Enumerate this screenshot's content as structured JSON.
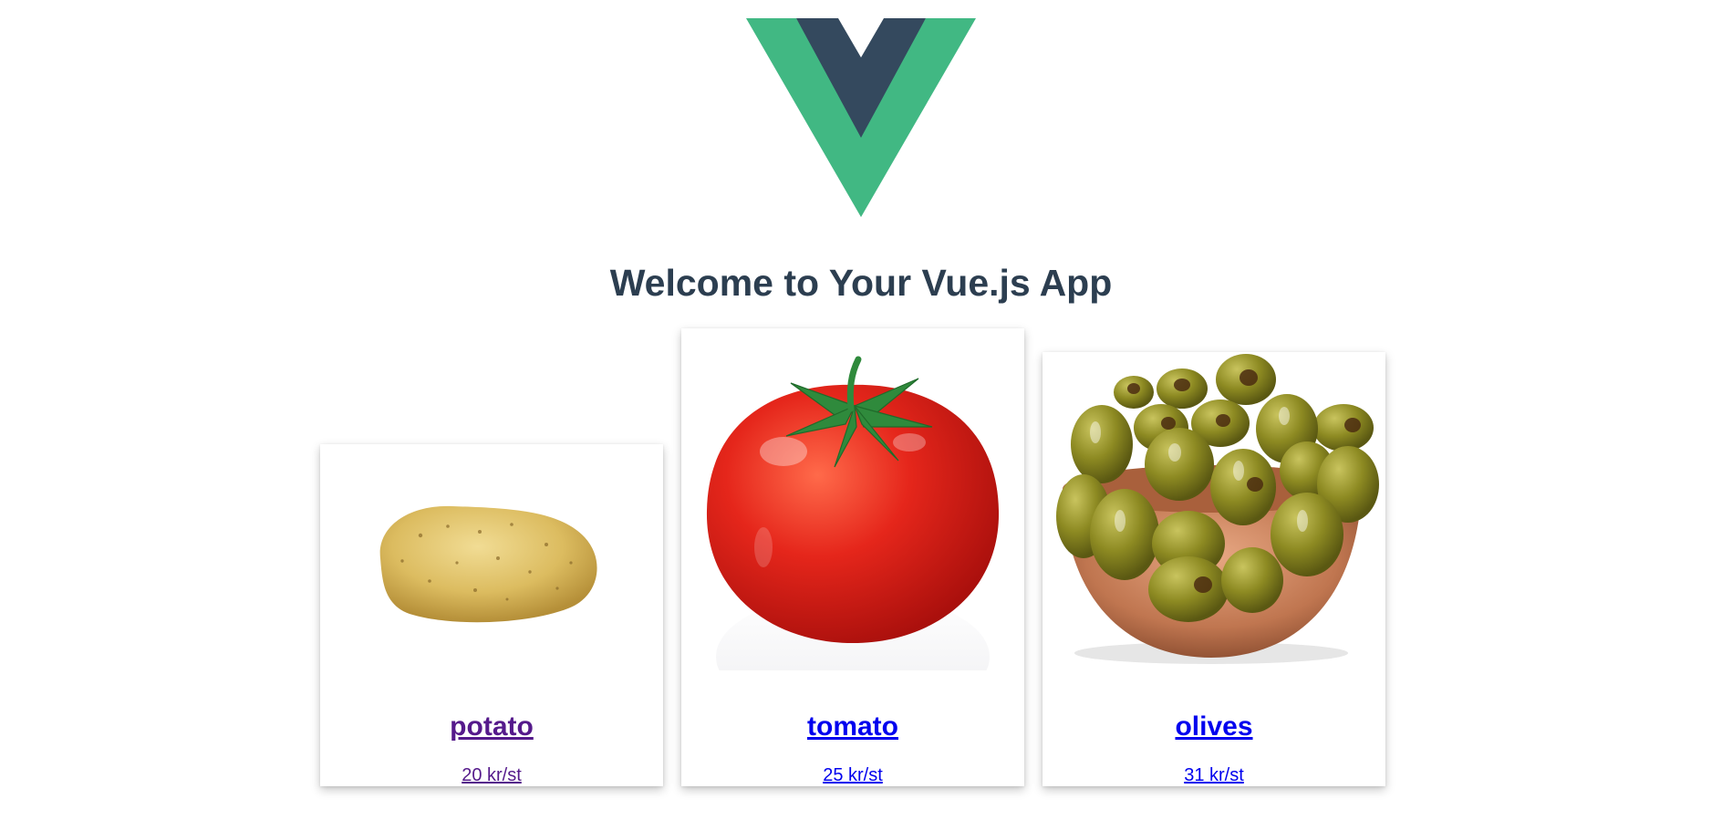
{
  "header": {
    "title": "Welcome to Your Vue.js App",
    "logo_icon": "vue-logo-icon"
  },
  "colors": {
    "vue_green": "#41b883",
    "vue_navy": "#34495e",
    "title": "#2c3e50",
    "link": "#0000ee",
    "visited_link": "#551a8b"
  },
  "products": [
    {
      "name": "potato",
      "price": "20 kr/st",
      "image_icon": "potato-image",
      "visited": true
    },
    {
      "name": "tomato",
      "price": "25 kr/st",
      "image_icon": "tomato-image",
      "visited": false
    },
    {
      "name": "olives",
      "price": "31 kr/st",
      "image_icon": "olives-image",
      "visited": false
    }
  ]
}
